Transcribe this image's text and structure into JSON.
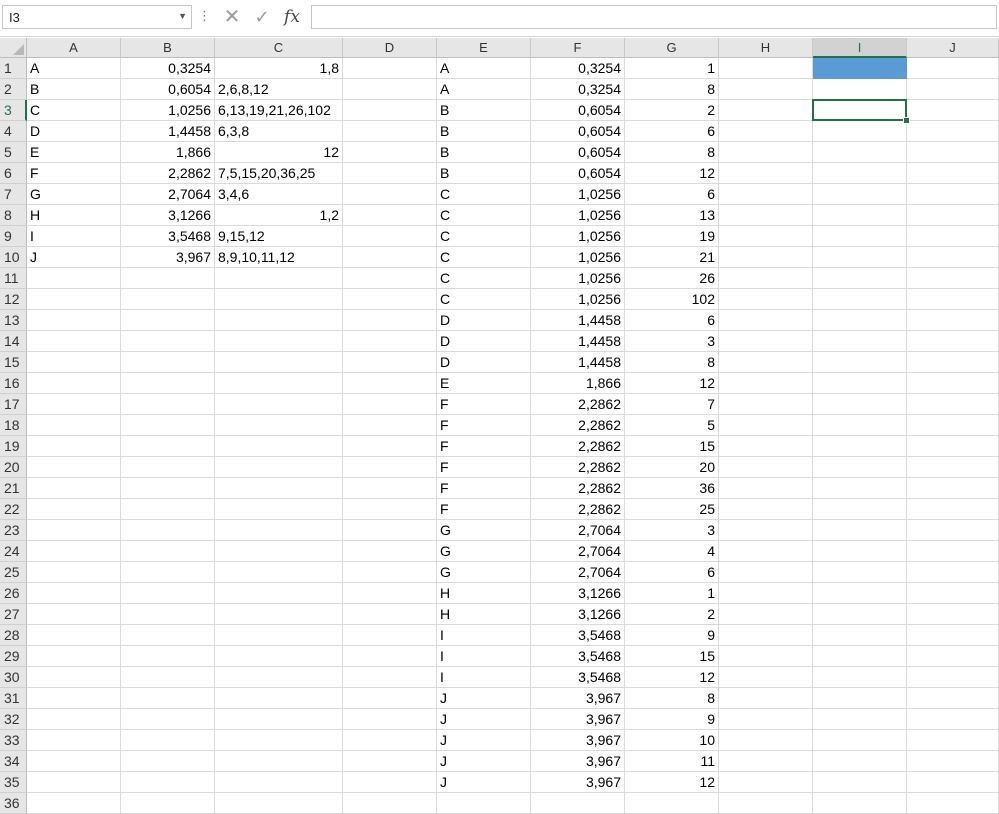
{
  "formula_bar": {
    "name_box": "I3",
    "separator_icon": "vertical-dots-icon",
    "cancel_icon": "close-icon",
    "enter_icon": "checkmark-icon",
    "function_icon": "fx-icon",
    "fx_label": "fx",
    "formula": ""
  },
  "sheet": {
    "selected_cell": "I3",
    "selected_column": "I",
    "selected_row": 3,
    "highlight_color": "#5b9bd5",
    "selection_color": "#217346",
    "highlighted_cells": [
      "I1"
    ],
    "columns": [
      "A",
      "B",
      "C",
      "D",
      "E",
      "F",
      "G",
      "H",
      "I",
      "J"
    ],
    "rows": [
      {
        "r": 1,
        "A": "A",
        "B": "0,3254",
        "C": "1,8",
        "E": "A",
        "F": "0,3254",
        "G": "1"
      },
      {
        "r": 2,
        "A": "B",
        "B": "0,6054",
        "C": "2,6,8,12",
        "E": "A",
        "F": "0,3254",
        "G": "8"
      },
      {
        "r": 3,
        "A": "C",
        "B": "1,0256",
        "C": "6,13,19,21,26,102",
        "E": "B",
        "F": "0,6054",
        "G": "2"
      },
      {
        "r": 4,
        "A": "D",
        "B": "1,4458",
        "C": "6,3,8",
        "E": "B",
        "F": "0,6054",
        "G": "6"
      },
      {
        "r": 5,
        "A": "E",
        "B": "1,866",
        "C": "12",
        "E": "B",
        "F": "0,6054",
        "G": "8"
      },
      {
        "r": 6,
        "A": "F",
        "B": "2,2862",
        "C": "7,5,15,20,36,25",
        "E": "B",
        "F": "0,6054",
        "G": "12"
      },
      {
        "r": 7,
        "A": "G",
        "B": "2,7064",
        "C": "3,4,6",
        "E": "C",
        "F": "1,0256",
        "G": "6"
      },
      {
        "r": 8,
        "A": "H",
        "B": "3,1266",
        "C": "1,2",
        "E": "C",
        "F": "1,0256",
        "G": "13"
      },
      {
        "r": 9,
        "A": "I",
        "B": "3,5468",
        "C": "9,15,12",
        "E": "C",
        "F": "1,0256",
        "G": "19"
      },
      {
        "r": 10,
        "A": "J",
        "B": "3,967",
        "C": "8,9,10,11,12",
        "E": "C",
        "F": "1,0256",
        "G": "21"
      },
      {
        "r": 11,
        "E": "C",
        "F": "1,0256",
        "G": "26"
      },
      {
        "r": 12,
        "E": "C",
        "F": "1,0256",
        "G": "102"
      },
      {
        "r": 13,
        "E": "D",
        "F": "1,4458",
        "G": "6"
      },
      {
        "r": 14,
        "E": "D",
        "F": "1,4458",
        "G": "3"
      },
      {
        "r": 15,
        "E": "D",
        "F": "1,4458",
        "G": "8"
      },
      {
        "r": 16,
        "E": "E",
        "F": "1,866",
        "G": "12"
      },
      {
        "r": 17,
        "E": "F",
        "F": "2,2862",
        "G": "7"
      },
      {
        "r": 18,
        "E": "F",
        "F": "2,2862",
        "G": "5"
      },
      {
        "r": 19,
        "E": "F",
        "F": "2,2862",
        "G": "15"
      },
      {
        "r": 20,
        "E": "F",
        "F": "2,2862",
        "G": "20"
      },
      {
        "r": 21,
        "E": "F",
        "F": "2,2862",
        "G": "36"
      },
      {
        "r": 22,
        "E": "F",
        "F": "2,2862",
        "G": "25"
      },
      {
        "r": 23,
        "E": "G",
        "F": "2,7064",
        "G": "3"
      },
      {
        "r": 24,
        "E": "G",
        "F": "2,7064",
        "G": "4"
      },
      {
        "r": 25,
        "E": "G",
        "F": "2,7064",
        "G": "6"
      },
      {
        "r": 26,
        "E": "H",
        "F": "3,1266",
        "G": "1"
      },
      {
        "r": 27,
        "E": "H",
        "F": "3,1266",
        "G": "2"
      },
      {
        "r": 28,
        "E": "I",
        "F": "3,5468",
        "G": "9"
      },
      {
        "r": 29,
        "E": "I",
        "F": "3,5468",
        "G": "15"
      },
      {
        "r": 30,
        "E": "I",
        "F": "3,5468",
        "G": "12"
      },
      {
        "r": 31,
        "E": "J",
        "F": "3,967",
        "G": "8"
      },
      {
        "r": 32,
        "E": "J",
        "F": "3,967",
        "G": "9"
      },
      {
        "r": 33,
        "E": "J",
        "F": "3,967",
        "G": "10"
      },
      {
        "r": 34,
        "E": "J",
        "F": "3,967",
        "G": "11"
      },
      {
        "r": 35,
        "E": "J",
        "F": "3,967",
        "G": "12"
      },
      {
        "r": 36
      }
    ]
  }
}
